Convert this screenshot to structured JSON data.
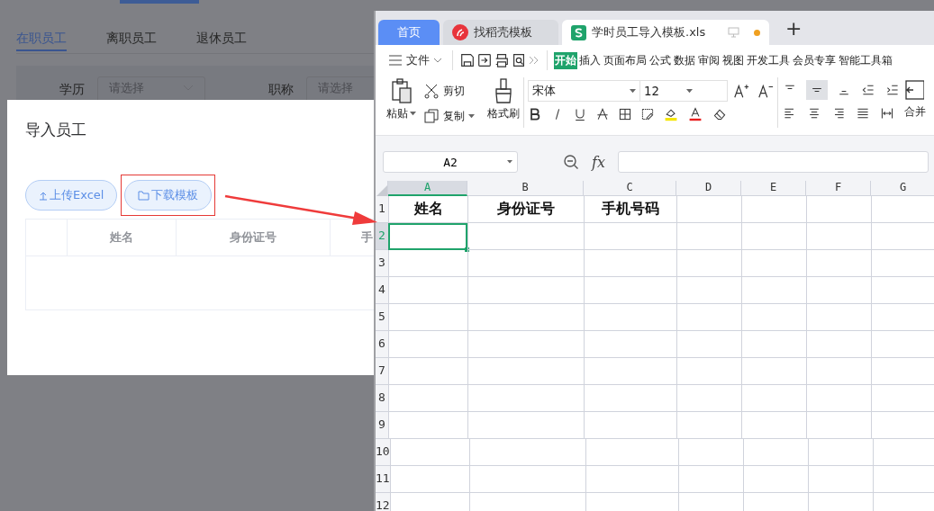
{
  "background_page": {
    "tabs": [
      {
        "label": "在职员工",
        "selected": true
      },
      {
        "label": "离职员工",
        "selected": false
      },
      {
        "label": "退休员工",
        "selected": false
      }
    ],
    "filters": [
      {
        "label": "学历",
        "placeholder": "请选择"
      },
      {
        "label": "职称",
        "placeholder": "请选择"
      }
    ]
  },
  "dialog": {
    "title": "导入员工",
    "buttons": [
      {
        "label": "上传Excel",
        "kind": "upload",
        "highlighted": false
      },
      {
        "label": "下载模板",
        "kind": "folder",
        "highlighted": true
      }
    ],
    "table": {
      "columns": [
        "姓名",
        "身份证号",
        "手"
      ]
    }
  },
  "spreadsheet_window": {
    "tabs": [
      {
        "label": "首页",
        "kind": "home",
        "selected": false
      },
      {
        "label": "找稻壳模板",
        "kind": "template",
        "selected": false
      },
      {
        "label": "学时员工导入模板.xls",
        "kind": "file",
        "selected": true,
        "unsaved": true
      }
    ],
    "new_tab": "+",
    "file_menu": "文件",
    "menu_tabs": [
      {
        "label": "开始",
        "selected": true
      },
      {
        "label": "插入",
        "selected": false
      },
      {
        "label": "页面布局",
        "selected": false
      },
      {
        "label": "公式",
        "selected": false
      },
      {
        "label": "数据",
        "selected": false
      },
      {
        "label": "审阅",
        "selected": false
      },
      {
        "label": "视图",
        "selected": false
      },
      {
        "label": "开发工具",
        "selected": false
      },
      {
        "label": "会员专享",
        "selected": false
      },
      {
        "label": "智能工具箱",
        "selected": false
      }
    ],
    "ribbon": {
      "paste": "粘贴",
      "cut": "剪切",
      "copy": "复制",
      "format_painter": "格式刷",
      "font": "宋体",
      "font_size": "12",
      "merge": "合并"
    },
    "name_box": "A2",
    "formula_label": "fx",
    "sheet": {
      "columns": [
        {
          "label": "A",
          "selected": true
        },
        {
          "label": "B",
          "selected": false
        },
        {
          "label": "C",
          "selected": false
        },
        {
          "label": "D",
          "selected": false
        },
        {
          "label": "E",
          "selected": false
        },
        {
          "label": "F",
          "selected": false
        },
        {
          "label": "G",
          "selected": false
        }
      ],
      "rows": [
        {
          "label": "1",
          "selected": false,
          "cells": [
            "姓名",
            "身份证号",
            "手机号码"
          ]
        },
        {
          "label": "2",
          "selected": true
        },
        {
          "label": "3",
          "selected": false
        },
        {
          "label": "4",
          "selected": false
        },
        {
          "label": "5",
          "selected": false
        },
        {
          "label": "6",
          "selected": false
        },
        {
          "label": "7",
          "selected": false
        },
        {
          "label": "8",
          "selected": false
        },
        {
          "label": "9",
          "selected": false
        },
        {
          "label": "10",
          "selected": false
        },
        {
          "label": "11",
          "selected": false
        },
        {
          "label": "12",
          "selected": false
        }
      ]
    }
  }
}
